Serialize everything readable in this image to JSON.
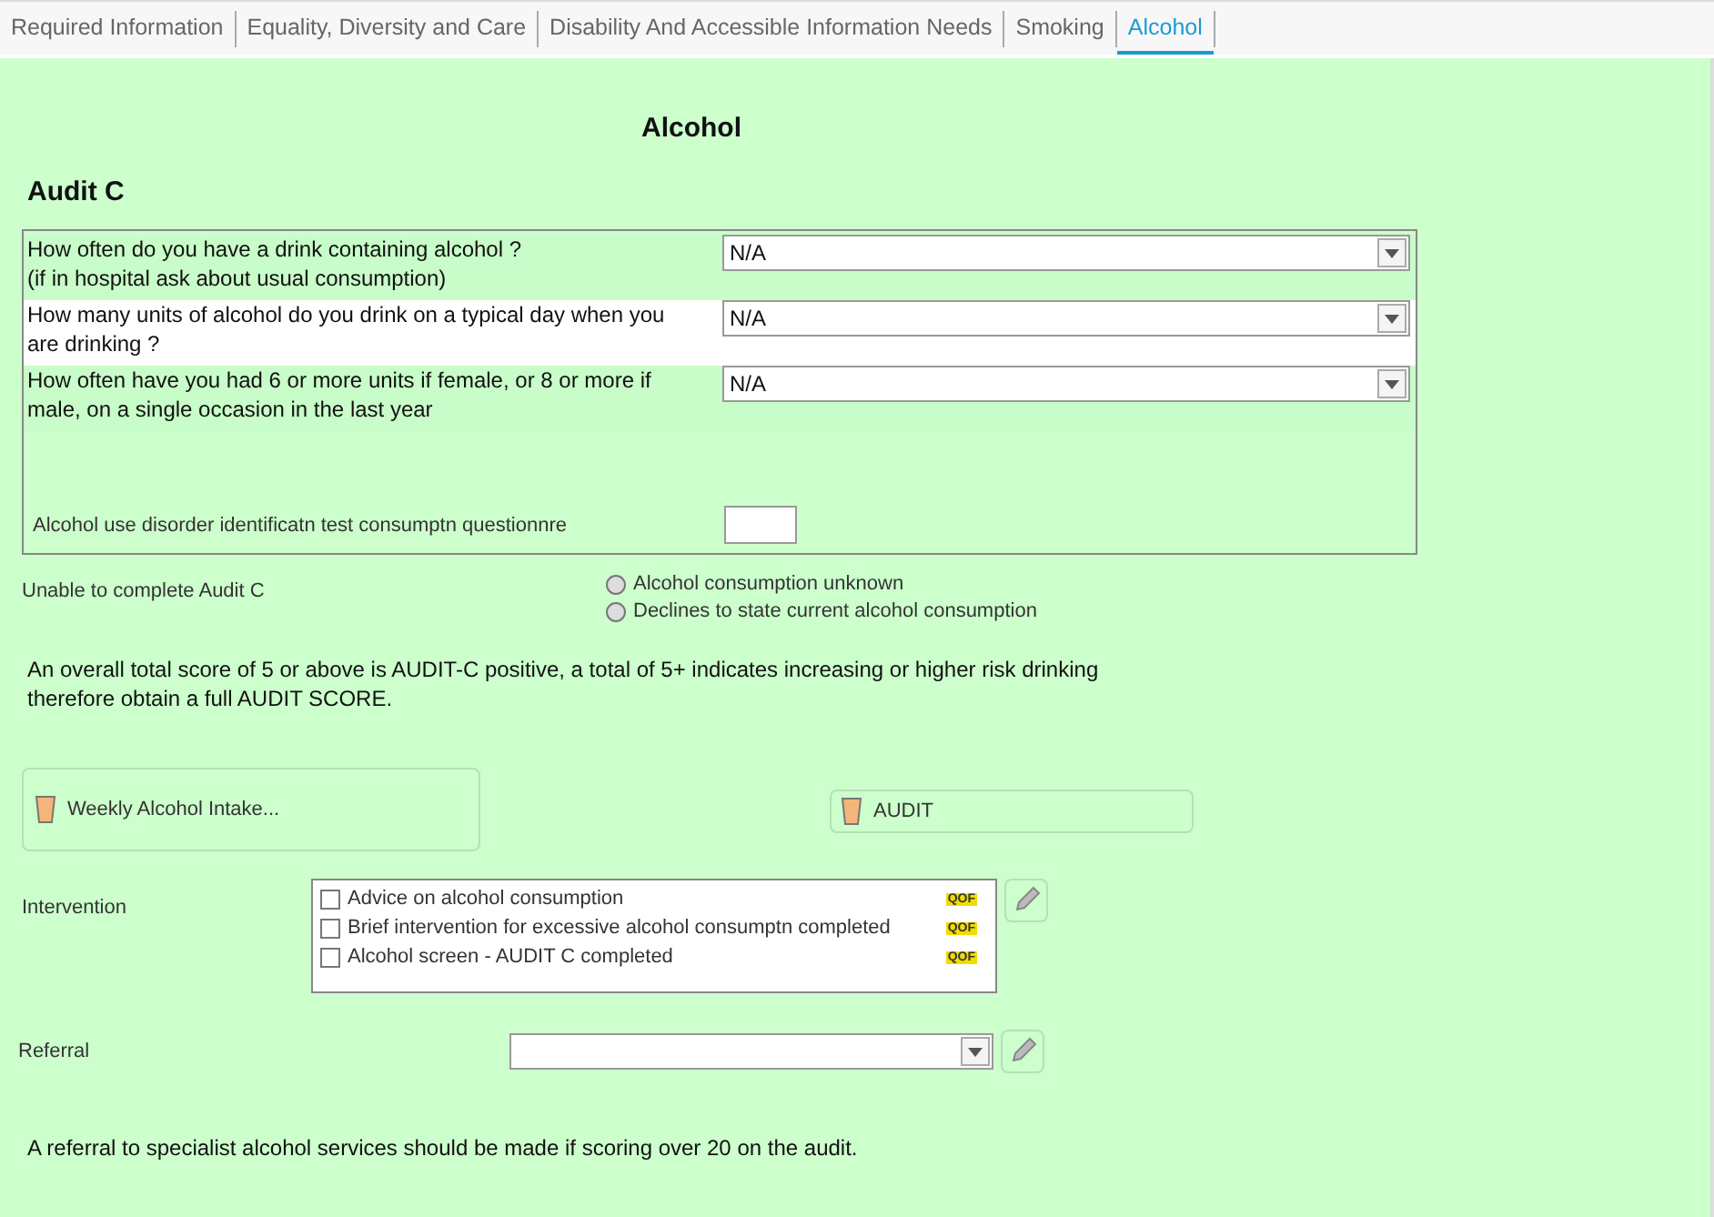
{
  "tabs": [
    {
      "label": "Required Information",
      "selected": false
    },
    {
      "label": "Equality, Diversity and Care",
      "selected": false
    },
    {
      "label": "Disability And Accessible Information Needs",
      "selected": false
    },
    {
      "label": "Smoking",
      "selected": false
    },
    {
      "label": "Alcohol",
      "selected": true
    }
  ],
  "title": "Alcohol",
  "section_heading": "Audit C",
  "questions": [
    {
      "text": "How often do you have a drink containing alcohol ?\n(if in hospital ask about usual consumption)",
      "value": "N/A",
      "highlighted": false
    },
    {
      "text": "How many units of alcohol do you drink on a typical day when you are drinking ?",
      "value": "N/A",
      "highlighted": true
    },
    {
      "text": "How often have you had 6 or more units if female, or 8 or more if male, on a single occasion in the last year",
      "value": "N/A",
      "highlighted": false
    }
  ],
  "score": {
    "label": "Alcohol use disorder identificatn test consumptn questionnre"
  },
  "unable": {
    "label": "Unable to complete Audit C",
    "options": [
      {
        "label": "Alcohol consumption unknown",
        "selected": false
      },
      {
        "label": "Declines to state current alcohol consumption",
        "selected": false
      }
    ]
  },
  "info_text": "An overall total score of 5 or above is AUDIT-C positive, a total of 5+ indicates increasing or higher risk drinking therefore obtain a full AUDIT SCORE.",
  "weekly_button": "Weekly Alcohol Intake...",
  "audit_button": "AUDIT",
  "intervention": {
    "label": "Intervention",
    "items": [
      {
        "label": "Advice on alcohol consumption",
        "checked": false,
        "badge": "QOF"
      },
      {
        "label": "Brief intervention for excessive alcohol consumptn completed",
        "checked": false,
        "badge": "QOF"
      },
      {
        "label": "Alcohol screen - AUDIT C completed",
        "checked": false,
        "badge": "QOF"
      }
    ]
  },
  "referral": {
    "label": "Referral"
  },
  "footer_text": "A referral to specialist alcohol services should be made if scoring over 20 on the audit."
}
